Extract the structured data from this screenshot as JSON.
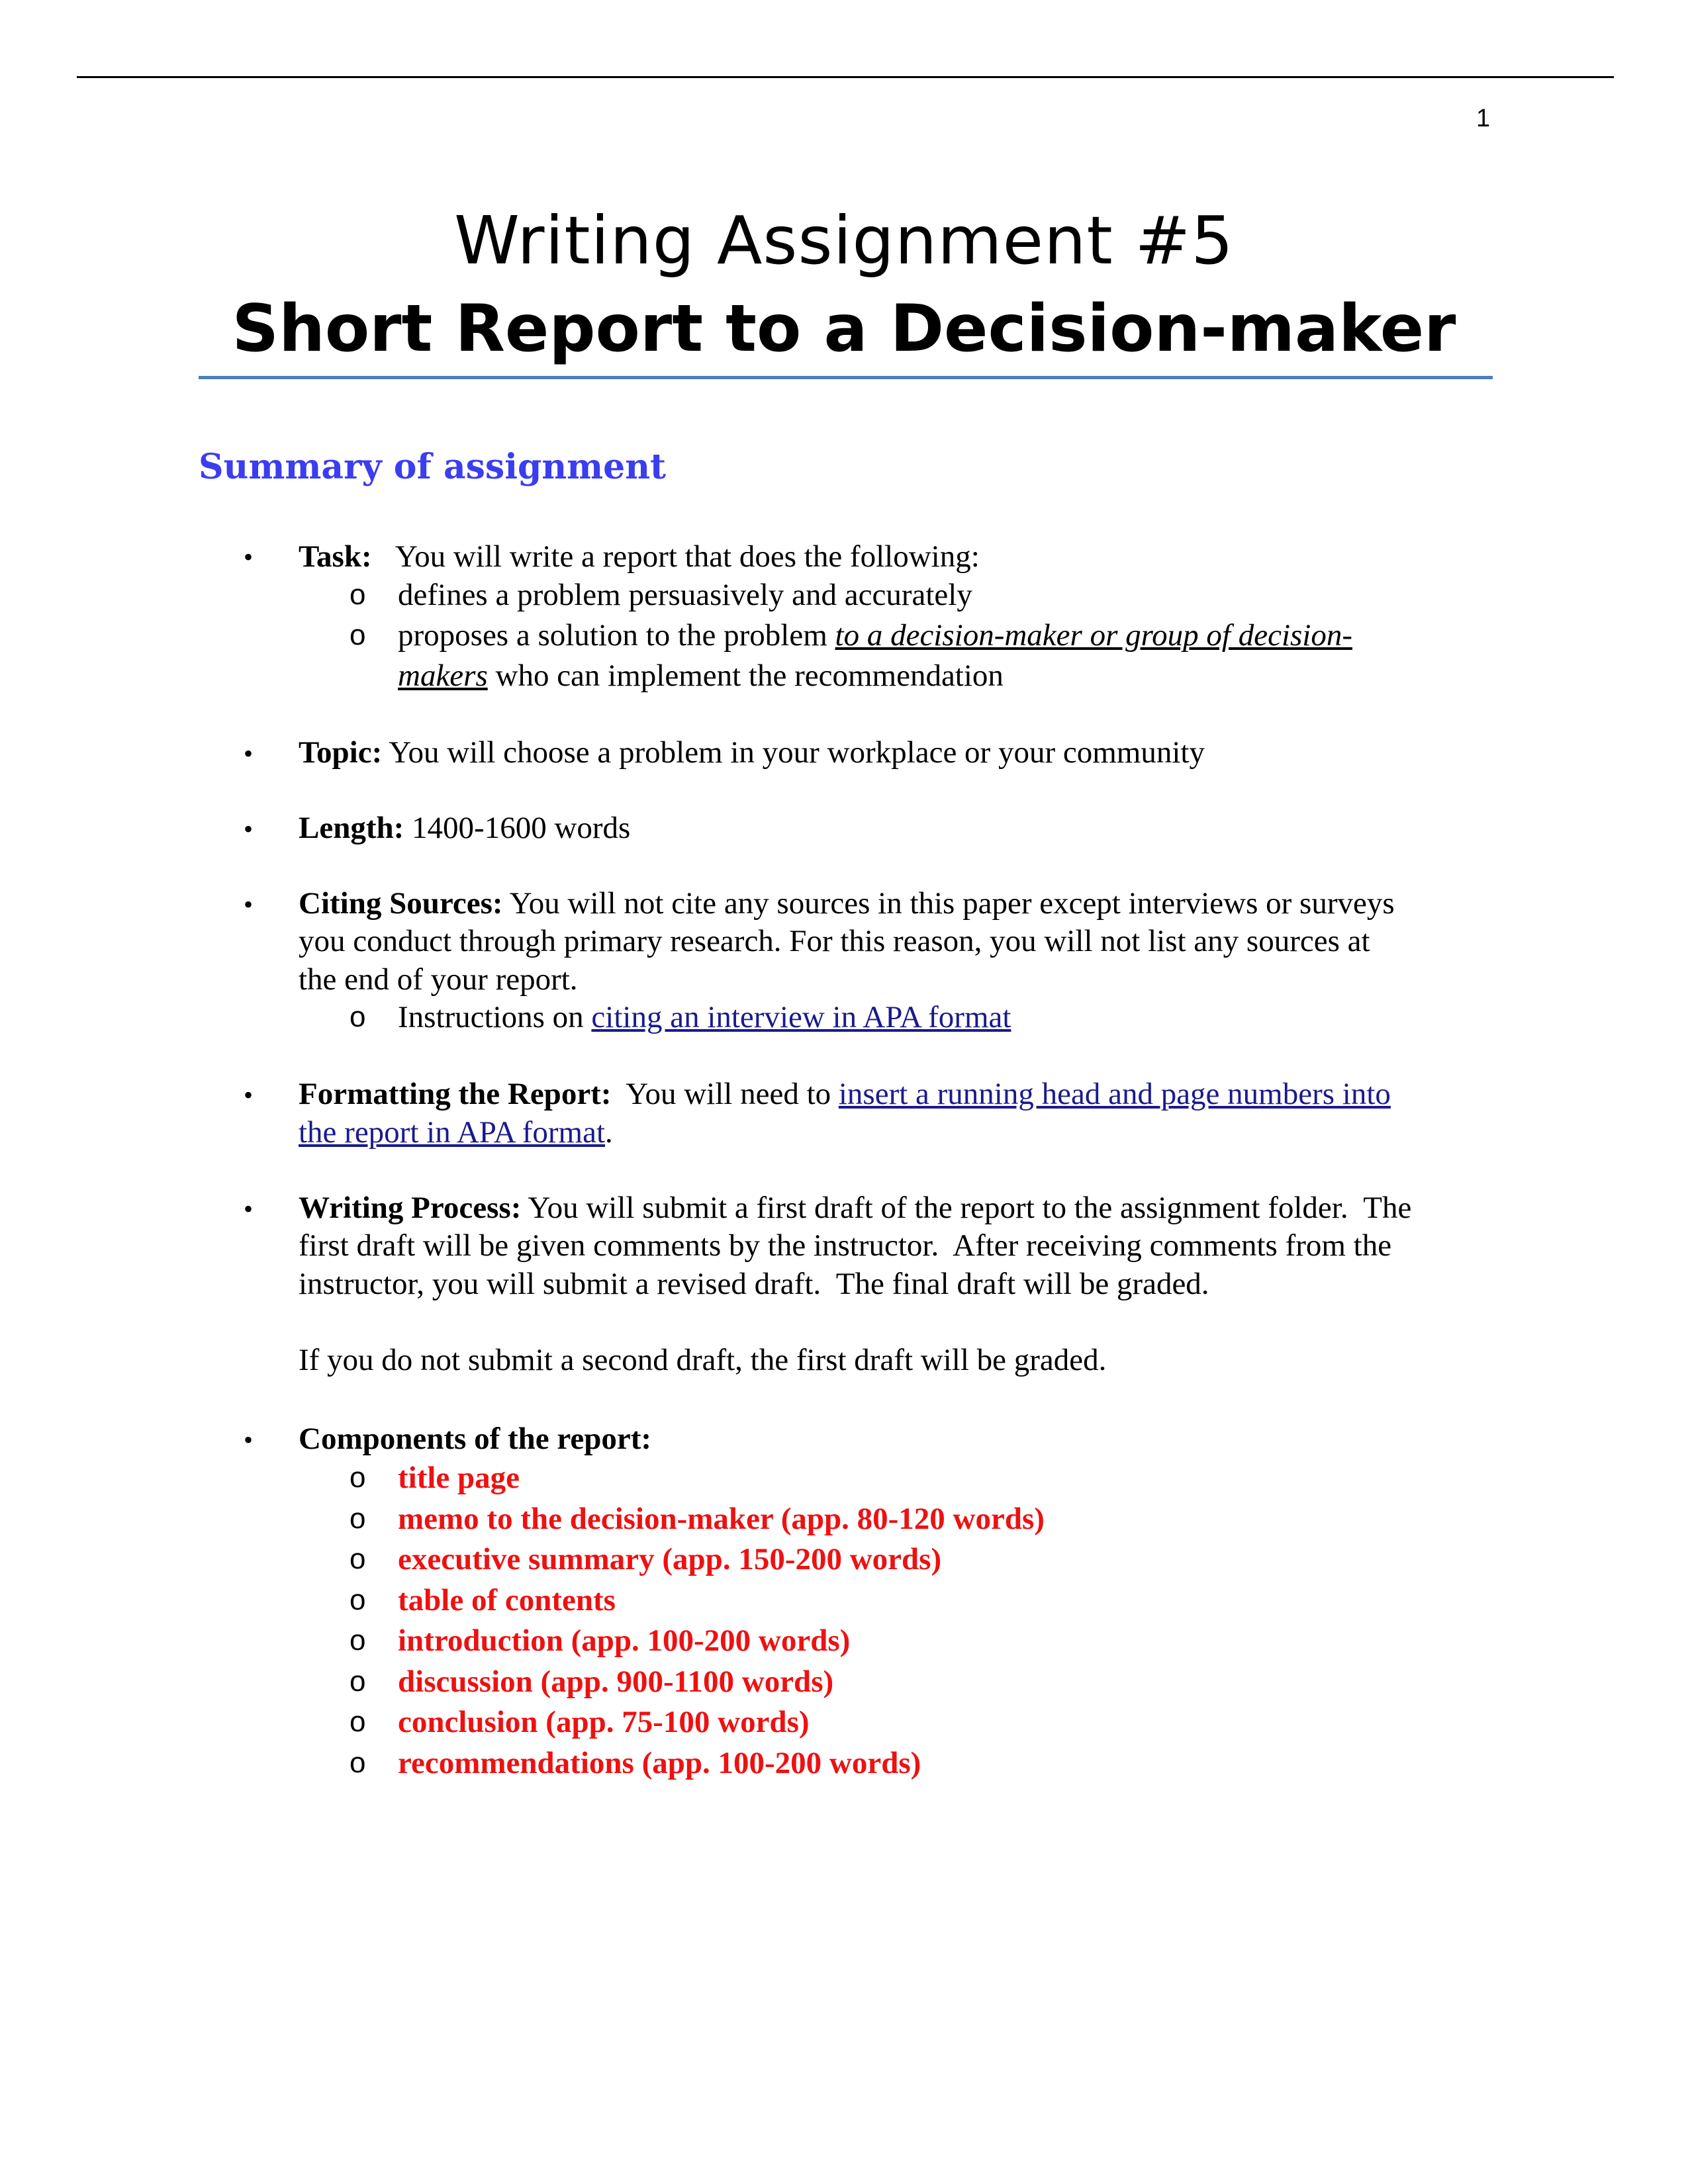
{
  "page_number": "1",
  "title_line1": "Writing Assignment #5",
  "title_line2": "Short Report to a Decision-maker",
  "section_heading": "Summary of assignment",
  "bullet_glyph": "•",
  "sub_glyph": "o",
  "task": {
    "label": "Task:",
    "text": "You will write a report that does the following:",
    "sub1": "defines a problem persuasively and accurately",
    "sub2_pre": "proposes a solution to the problem ",
    "sub2_em1": "to a decision-maker or group of decision-",
    "sub2_em2": "makers",
    "sub2_post": " who can implement the recommendation"
  },
  "topic": {
    "label": "Topic:",
    "text": " You will choose a problem in your workplace or your community"
  },
  "length": {
    "label": "Length:",
    "text": " 1400-1600 words"
  },
  "citing": {
    "label": "Citing Sources:",
    "l1": " You will not cite any sources in this paper except interviews or surveys",
    "l2": "you conduct through primary research.  For this reason, you will not list any sources at",
    "l3": "the end of your report.",
    "sub_pre": "Instructions on ",
    "sub_link": "citing an interview in APA format"
  },
  "formatting": {
    "label": "Formatting the Report:",
    "pre": "  You will need to ",
    "link1": "insert a running head and page numbers into ",
    "link2": "the report in APA format",
    "post": "."
  },
  "process": {
    "label": "Writing Process:",
    "l1": " You will submit a first draft of the report to the assignment folder.  The",
    "l2": "first draft will be given comments by the instructor.  After receiving comments from the",
    "l3": "instructor, you will submit a revised draft.  The final draft will be graded.",
    "l4": "If you do not submit a second draft, the first draft will be graded."
  },
  "components": {
    "label": "Components of the report:",
    "items": [
      "title page",
      "memo to the decision-maker (app. 80-120 words)",
      "executive summary (app. 150-200 words)",
      "table of contents",
      "introduction (app. 100-200 words)",
      "discussion (app. 900-1100 words)",
      "conclusion (app. 75-100 words)",
      "recommendations (app. 100-200 words)"
    ]
  },
  "colors": {
    "heading": "#3b3df0",
    "link": "#1a1a8c",
    "red": "#ee1111",
    "rule": "#4a7fc1"
  }
}
